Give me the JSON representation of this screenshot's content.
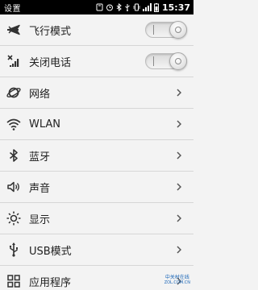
{
  "status_bar": {
    "title": "设置",
    "time": "15:37",
    "icons": [
      "sd-card-icon",
      "alarm-icon",
      "bluetooth-icon",
      "usb-icon",
      "vibrate-icon",
      "signal-icon",
      "battery-icon"
    ]
  },
  "settings": {
    "items": [
      {
        "label": "飞行模式",
        "icon": "airplane-icon",
        "control": "toggle"
      },
      {
        "label": "关闭电话",
        "icon": "phone-off-icon",
        "control": "toggle"
      },
      {
        "label": "网络",
        "icon": "network-icon",
        "control": "chevron"
      },
      {
        "label": "WLAN",
        "icon": "wifi-icon",
        "control": "chevron"
      },
      {
        "label": "蓝牙",
        "icon": "bluetooth-icon",
        "control": "chevron"
      },
      {
        "label": "声音",
        "icon": "volume-icon",
        "control": "chevron"
      },
      {
        "label": "显示",
        "icon": "brightness-icon",
        "control": "chevron"
      },
      {
        "label": "USB模式",
        "icon": "usb-icon",
        "control": "chevron"
      },
      {
        "label": "应用程序",
        "icon": "apps-grid-icon",
        "control": "chevron"
      }
    ]
  },
  "watermark": {
    "line1": "中关村在线",
    "line2": "ZOL.COM.CN"
  }
}
